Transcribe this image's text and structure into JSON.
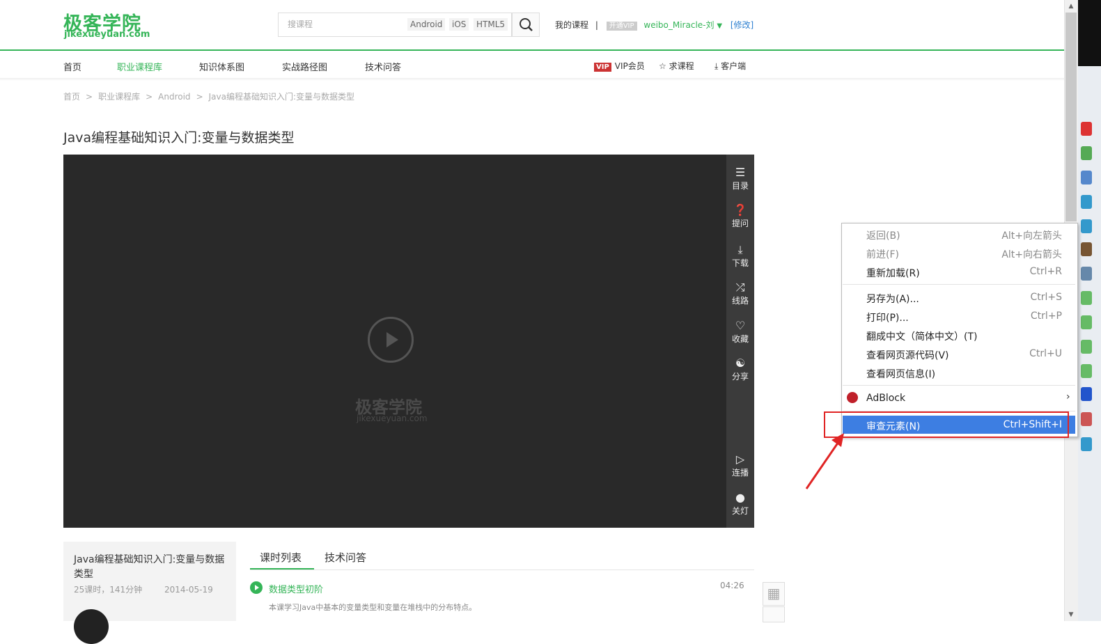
{
  "header": {
    "logo_cn": "极客学院",
    "logo_en": "jikexueyuan.com",
    "search_placeholder": "搜课程",
    "search_tags": [
      "Android",
      "iOS",
      "HTML5"
    ],
    "my_courses": "我的课程",
    "separator": "|",
    "vip_badge": "开通VIP",
    "username": "weibo_Miracle-刘",
    "edit_link": "[修改]"
  },
  "nav": {
    "items": [
      "首页",
      "职业课程库",
      "知识体系图",
      "实战路径图",
      "技术问答"
    ],
    "vip_tag": "VIP",
    "vip_label": "VIP会员",
    "request_course": "求课程",
    "client": "客户端"
  },
  "breadcrumb": [
    "首页",
    "职业课程库",
    "Android",
    "Java编程基础知识入门:变量与数据类型"
  ],
  "breadcrumb_sep": ">",
  "page_title": "Java编程基础知识入门:变量与数据类型",
  "player": {
    "watermark_cn": "极客学院",
    "watermark_en": "jikexueyuan.com",
    "sidebar": [
      {
        "label": "目录",
        "icon": "catalog-icon"
      },
      {
        "label": "提问",
        "icon": "question-icon"
      },
      {
        "label": "下载",
        "icon": "download-icon"
      },
      {
        "label": "线路",
        "icon": "shuffle-icon"
      },
      {
        "label": "收藏",
        "icon": "heart-icon"
      },
      {
        "label": "分享",
        "icon": "share-icon"
      },
      {
        "label": "连播",
        "icon": "autoplay-icon"
      },
      {
        "label": "关灯",
        "icon": "bulb-icon"
      }
    ]
  },
  "course_info": {
    "title": "Java编程基础知识入门:变量与数据类型",
    "meta_count": "25课时，141分钟",
    "meta_date": "2014-05-19"
  },
  "tabs": [
    "课时列表",
    "技术问答"
  ],
  "lesson": {
    "title": "数据类型初阶",
    "duration": "04:26",
    "desc": "本课学习Java中基本的变量类型和变量在堆栈中的分布特点。"
  },
  "context_menu": {
    "items": [
      {
        "label": "返回(B)",
        "shortcut": "Alt+向左箭头",
        "disabled": true
      },
      {
        "label": "前进(F)",
        "shortcut": "Alt+向右箭头",
        "disabled": true
      },
      {
        "label": "重新加载(R)",
        "shortcut": "Ctrl+R",
        "disabled": false
      },
      {
        "label": "另存为(A)...",
        "shortcut": "Ctrl+S",
        "disabled": false
      },
      {
        "label": "打印(P)...",
        "shortcut": "Ctrl+P",
        "disabled": false
      },
      {
        "label": "翻成中文（简体中文）(T)",
        "shortcut": "",
        "disabled": false
      },
      {
        "label": "查看网页源代码(V)",
        "shortcut": "Ctrl+U",
        "disabled": false
      },
      {
        "label": "查看网页信息(I)",
        "shortcut": "",
        "disabled": false
      },
      {
        "label": "AdBlock",
        "shortcut": "",
        "disabled": false
      },
      {
        "label": "审查元素(N)",
        "shortcut": "Ctrl+Shift+I",
        "disabled": false
      }
    ],
    "submenu_arrow": "›"
  },
  "colors": {
    "brand_green": "#35b558",
    "menu_highlight": "#3d7ee2",
    "annotation_red": "#e02424",
    "player_bg": "#292929"
  }
}
